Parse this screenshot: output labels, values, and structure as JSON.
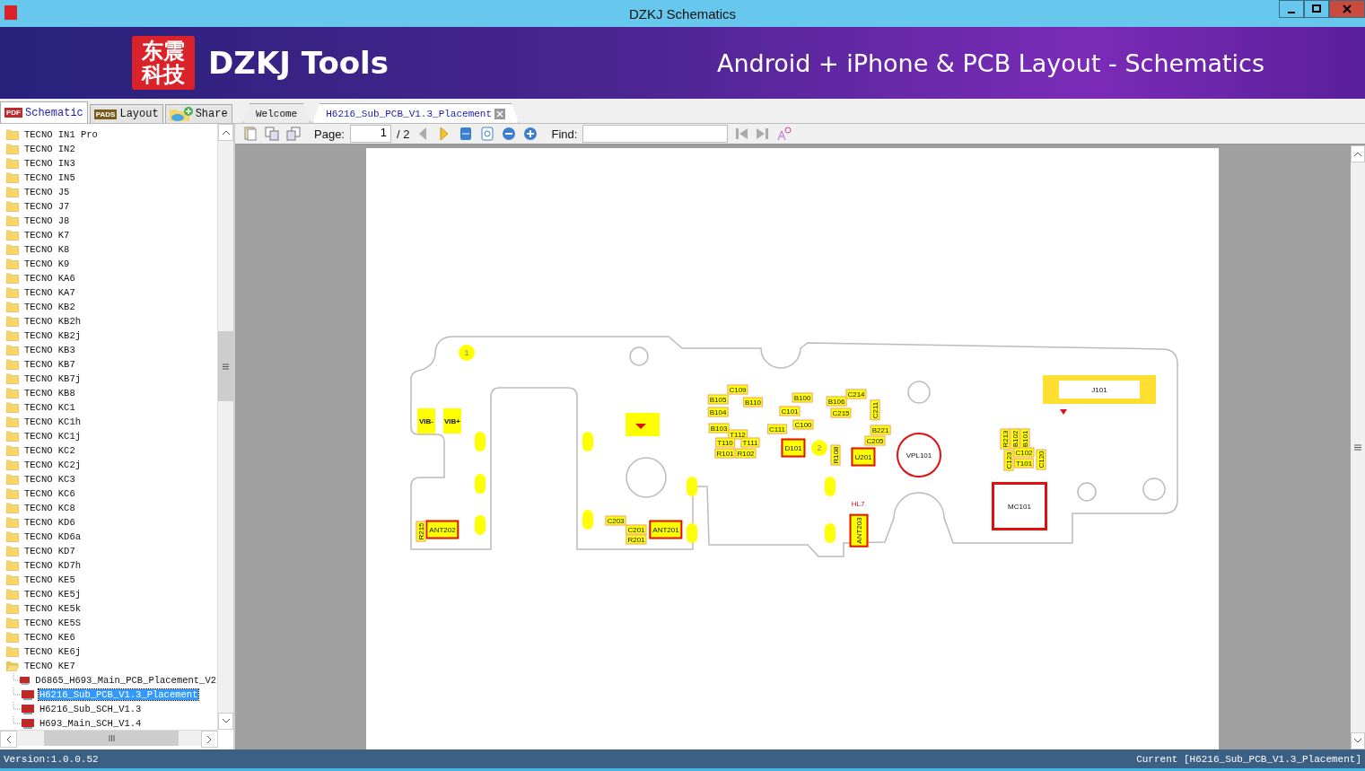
{
  "window": {
    "title": "DZKJ Schematics"
  },
  "banner": {
    "logo_lines": [
      "东震",
      "科技"
    ],
    "brand": "DZKJ Tools",
    "tagline": "Android + iPhone & PCB Layout - Schematics"
  },
  "side_tabs": [
    {
      "label": "Schematic",
      "icon_text": "PDF",
      "selected": true
    },
    {
      "label": "Layout",
      "icon_text": "PADS",
      "selected": false
    },
    {
      "label": "Share",
      "selected": false
    }
  ],
  "doc_tabs": [
    {
      "label": "Welcome",
      "selected": false,
      "closable": false
    },
    {
      "label": "H6216_Sub_PCB_V1.3_Placement",
      "selected": true,
      "closable": true
    }
  ],
  "toolbar": {
    "page_label": "Page:",
    "page_value": "1",
    "page_total": "/ 2",
    "find_label": "Find:"
  },
  "tree": [
    {
      "label": "TECNO IN1 Pro",
      "expanded": false
    },
    {
      "label": "TECNO IN2",
      "expanded": false
    },
    {
      "label": "TECNO IN3",
      "expanded": false
    },
    {
      "label": "TECNO IN5",
      "expanded": false
    },
    {
      "label": "TECNO J5",
      "expanded": false
    },
    {
      "label": "TECNO J7",
      "expanded": false
    },
    {
      "label": "TECNO J8",
      "expanded": false
    },
    {
      "label": "TECNO K7",
      "expanded": false
    },
    {
      "label": "TECNO K8",
      "expanded": false
    },
    {
      "label": "TECNO K9",
      "expanded": false
    },
    {
      "label": "TECNO KA6",
      "expanded": false
    },
    {
      "label": "TECNO KA7",
      "expanded": false
    },
    {
      "label": "TECNO KB2",
      "expanded": false
    },
    {
      "label": "TECNO KB2h",
      "expanded": false
    },
    {
      "label": "TECNO KB2j",
      "expanded": false
    },
    {
      "label": "TECNO KB3",
      "expanded": false
    },
    {
      "label": "TECNO KB7",
      "expanded": false
    },
    {
      "label": "TECNO KB7j",
      "expanded": false
    },
    {
      "label": "TECNO KB8",
      "expanded": false
    },
    {
      "label": "TECNO KC1",
      "expanded": false
    },
    {
      "label": "TECNO KC1h",
      "expanded": false
    },
    {
      "label": "TECNO KC1j",
      "expanded": false
    },
    {
      "label": "TECNO KC2",
      "expanded": false
    },
    {
      "label": "TECNO KC2j",
      "expanded": false
    },
    {
      "label": "TECNO KC3",
      "expanded": false
    },
    {
      "label": "TECNO KC6",
      "expanded": false
    },
    {
      "label": "TECNO KC8",
      "expanded": false
    },
    {
      "label": "TECNO KD6",
      "expanded": false
    },
    {
      "label": "TECNO KD6a",
      "expanded": false
    },
    {
      "label": "TECNO KD7",
      "expanded": false
    },
    {
      "label": "TECNO KD7h",
      "expanded": false
    },
    {
      "label": "TECNO KE5",
      "expanded": false
    },
    {
      "label": "TECNO KE5j",
      "expanded": false
    },
    {
      "label": "TECNO KE5k",
      "expanded": false
    },
    {
      "label": "TECNO KE5S",
      "expanded": false
    },
    {
      "label": "TECNO KE6",
      "expanded": false
    },
    {
      "label": "TECNO KE6j",
      "expanded": false
    },
    {
      "label": "TECNO KE7",
      "expanded": true,
      "children": [
        {
          "label": "D6865_H693_Main_PCB_Placement_V2",
          "selected": false
        },
        {
          "label": "H6216_Sub_PCB_V1.3_Placement",
          "selected": true
        },
        {
          "label": "H6216_Sub_SCH_V1.3",
          "selected": false
        },
        {
          "label": "H693_Main_SCH_V1.4",
          "selected": false
        }
      ]
    }
  ],
  "pcb": {
    "parts": [
      {
        "label": "1",
        "kind": "numpad"
      },
      {
        "label": "VIB-",
        "kind": "pad"
      },
      {
        "label": "VIB+",
        "kind": "pad"
      },
      {
        "label": "ANT202",
        "kind": "ic"
      },
      {
        "label": "R215",
        "kind": "smd"
      },
      {
        "label": "C203",
        "kind": "smd"
      },
      {
        "label": "C201",
        "kind": "smd"
      },
      {
        "label": "R201",
        "kind": "smd"
      },
      {
        "label": "ANT201",
        "kind": "ic"
      },
      {
        "label": "C109",
        "kind": "smd"
      },
      {
        "label": "B105",
        "kind": "smd"
      },
      {
        "label": "B110",
        "kind": "smd"
      },
      {
        "label": "B104",
        "kind": "smd"
      },
      {
        "label": "B103",
        "kind": "smd"
      },
      {
        "label": "T112",
        "kind": "smd"
      },
      {
        "label": "T110",
        "kind": "smd"
      },
      {
        "label": "T111",
        "kind": "smd"
      },
      {
        "label": "R101",
        "kind": "smd"
      },
      {
        "label": "R102",
        "kind": "smd"
      },
      {
        "label": "B100",
        "kind": "smd"
      },
      {
        "label": "C101",
        "kind": "smd"
      },
      {
        "label": "C111",
        "kind": "smd"
      },
      {
        "label": "C100",
        "kind": "smd"
      },
      {
        "label": "D101",
        "kind": "ic"
      },
      {
        "label": "2",
        "kind": "numpad"
      },
      {
        "label": "B106",
        "kind": "smd"
      },
      {
        "label": "C214",
        "kind": "smd"
      },
      {
        "label": "C211",
        "kind": "smd"
      },
      {
        "label": "C215",
        "kind": "smd"
      },
      {
        "label": "B221",
        "kind": "smd"
      },
      {
        "label": "C205",
        "kind": "smd"
      },
      {
        "label": "R108",
        "kind": "smd"
      },
      {
        "label": "U201",
        "kind": "ic"
      },
      {
        "label": "VPL101",
        "kind": "ring"
      },
      {
        "label": "HL7",
        "kind": "marker"
      },
      {
        "label": "ANT203",
        "kind": "ic"
      },
      {
        "label": "J101",
        "kind": "connector"
      },
      {
        "label": "R213",
        "kind": "smd"
      },
      {
        "label": "B102",
        "kind": "smd"
      },
      {
        "label": "B101",
        "kind": "smd"
      },
      {
        "label": "C123",
        "kind": "smd"
      },
      {
        "label": "C102",
        "kind": "smd"
      },
      {
        "label": "T101",
        "kind": "smd"
      },
      {
        "label": "C120",
        "kind": "smd"
      },
      {
        "label": "MC101",
        "kind": "mic"
      }
    ]
  },
  "status_bar": {
    "version": "Version:1.0.0.52",
    "current": "Current [H6216_Sub_PCB_V1.3_Placement]"
  }
}
